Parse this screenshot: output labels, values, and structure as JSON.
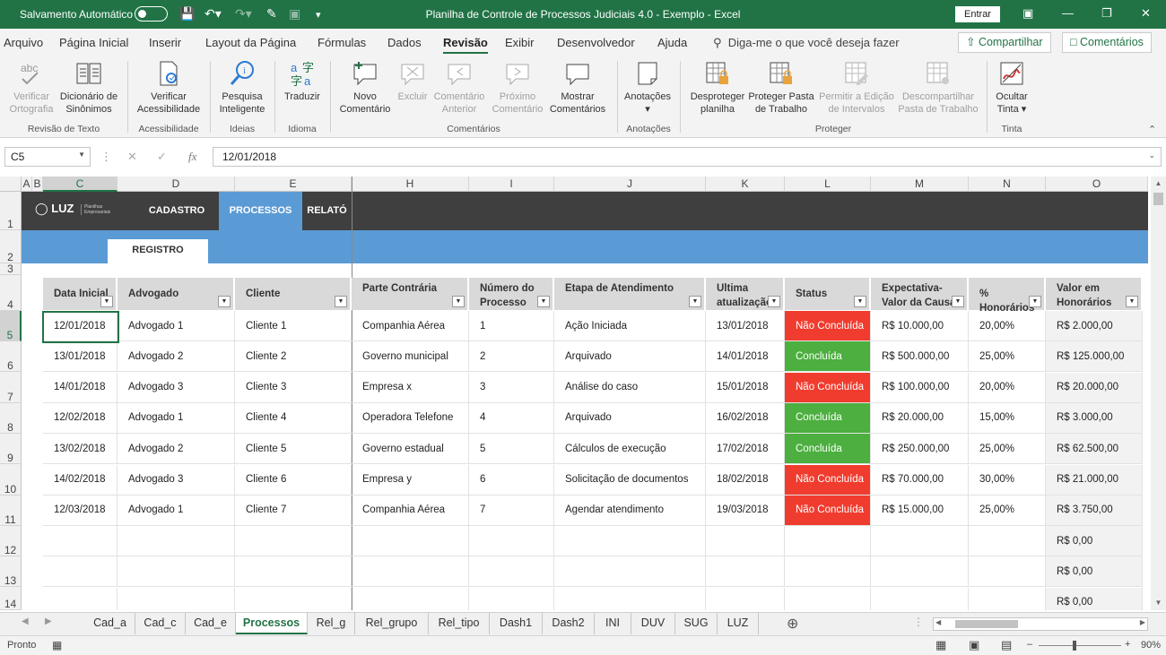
{
  "titlebar": {
    "autosave_label": "Salvamento Automático",
    "window_title": "Planilha de Controle de Processos Judiciais 4.0 - Exemplo  -  Excel",
    "signin_label": "Entrar"
  },
  "menu": {
    "items": [
      "Arquivo",
      "Página Inicial",
      "Inserir",
      "Layout da Página",
      "Fórmulas",
      "Dados",
      "Revisão",
      "Exibir",
      "Desenvolvedor",
      "Ajuda"
    ],
    "active": "Revisão",
    "tellme": "Diga-me o que você deseja fazer",
    "share": "Compartilhar",
    "comments": "Comentários"
  },
  "ribbon": {
    "buttons": [
      {
        "l1": "Verificar",
        "l2": "Ortografia"
      },
      {
        "l1": "Dicionário de",
        "l2": "Sinônimos"
      },
      {
        "l1": "Verificar",
        "l2": "Acessibilidade"
      },
      {
        "l1": "Pesquisa",
        "l2": "Inteligente"
      },
      {
        "l1": "Traduzir",
        "l2": ""
      },
      {
        "l1": "Novo",
        "l2": "Comentário"
      },
      {
        "l1": "Excluir",
        "l2": ""
      },
      {
        "l1": "Comentário",
        "l2": "Anterior"
      },
      {
        "l1": "Próximo",
        "l2": "Comentário"
      },
      {
        "l1": "Mostrar",
        "l2": "Comentários"
      },
      {
        "l1": "Anotações",
        "l2": "▾"
      },
      {
        "l1": "Desproteger",
        "l2": "planilha"
      },
      {
        "l1": "Proteger Pasta",
        "l2": "de Trabalho"
      },
      {
        "l1": "Permitir a Edição",
        "l2": "de Intervalos"
      },
      {
        "l1": "Descompartilhar",
        "l2": "Pasta de Trabalho"
      },
      {
        "l1": "Ocultar",
        "l2": "Tinta ▾"
      }
    ],
    "groups": [
      "Revisão de Texto",
      "Acessibilidade",
      "Ideias",
      "Idioma",
      "Comentários",
      "Anotações",
      "Proteger",
      "Tinta"
    ]
  },
  "formula_bar": {
    "name_box": "C5",
    "fx": "fx",
    "value": "12/01/2018"
  },
  "columns": [
    "A",
    "B",
    "C",
    "D",
    "E",
    "H",
    "I",
    "J",
    "K",
    "L",
    "M",
    "N",
    "O"
  ],
  "rows": [
    "1",
    "2",
    "3",
    "4",
    "5",
    "6",
    "7",
    "8",
    "9",
    "10",
    "11",
    "12",
    "13",
    "14"
  ],
  "dashboard": {
    "logo": "LUZ",
    "logo_sub": "Planilhas Empresariais",
    "tabs": [
      "CADASTRO",
      "PROCESSOS",
      "RELATÓ"
    ],
    "subtab": "REGISTRO"
  },
  "table": {
    "headers": [
      "Data Inicial",
      "Advogado",
      "Cliente",
      "Parte Contrária",
      "Número do Processo",
      "Etapa de Atendimento",
      "Ultima atualização",
      "Status",
      "Expectativa-Valor da Causa",
      "% Honorários",
      "Valor em Honorários"
    ],
    "rows": [
      [
        "12/01/2018",
        "Advogado 1",
        "Cliente 1",
        "Companhia Aérea",
        "1",
        "Ação Iniciada",
        "13/01/2018",
        "Não Concluída",
        "R$ 10.000,00",
        "20,00%",
        "R$ 2.000,00"
      ],
      [
        "13/01/2018",
        "Advogado 2",
        "Cliente 2",
        "Governo municipal",
        "2",
        "Arquivado",
        "14/01/2018",
        "Concluída",
        "R$ 500.000,00",
        "25,00%",
        "R$ 125.000,00"
      ],
      [
        "14/01/2018",
        "Advogado 3",
        "Cliente 3",
        "Empresa x",
        "3",
        "Análise do caso",
        "15/01/2018",
        "Não Concluída",
        "R$ 100.000,00",
        "20,00%",
        "R$ 20.000,00"
      ],
      [
        "12/02/2018",
        "Advogado 1",
        "Cliente 4",
        "Operadora Telefone",
        "4",
        "Arquivado",
        "16/02/2018",
        "Concluída",
        "R$ 20.000,00",
        "15,00%",
        "R$ 3.000,00"
      ],
      [
        "13/02/2018",
        "Advogado 2",
        "Cliente 5",
        "Governo estadual",
        "5",
        "Cálculos de execução",
        "17/02/2018",
        "Concluída",
        "R$ 250.000,00",
        "25,00%",
        "R$ 62.500,00"
      ],
      [
        "14/02/2018",
        "Advogado 3",
        "Cliente 6",
        "Empresa y",
        "6",
        "Solicitação de documentos",
        "18/02/2018",
        "Não Concluída",
        "R$ 70.000,00",
        "30,00%",
        "R$ 21.000,00"
      ],
      [
        "12/03/2018",
        "Advogado 1",
        "Cliente 7",
        "Companhia Aérea",
        "7",
        "Agendar atendimento",
        "19/03/2018",
        "Não Concluída",
        "R$ 15.000,00",
        "25,00%",
        "R$ 3.750,00"
      ],
      [
        "",
        "",
        "",
        "",
        "",
        "",
        "",
        "",
        "",
        "",
        "R$ 0,00"
      ],
      [
        "",
        "",
        "",
        "",
        "",
        "",
        "",
        "",
        "",
        "",
        "R$ 0,00"
      ],
      [
        "",
        "",
        "",
        "",
        "",
        "",
        "",
        "",
        "",
        "",
        "R$ 0,00"
      ]
    ],
    "status_colors": {
      "Concluída": "#4caf3f",
      "Não Concluída": "#f03c2e"
    }
  },
  "sheets": {
    "tabs": [
      "Cad_a",
      "Cad_c",
      "Cad_e",
      "Processos",
      "Rel_g",
      "Rel_grupo",
      "Rel_tipo",
      "Dash1",
      "Dash2",
      "INI",
      "DUV",
      "SUG",
      "LUZ"
    ],
    "active": "Processos"
  },
  "status": {
    "ready": "Pronto",
    "zoom": "90%"
  },
  "colors": {
    "excel_green": "#217346",
    "nav_dark": "#3f3f3f",
    "nav_blue": "#5b9bd5"
  }
}
